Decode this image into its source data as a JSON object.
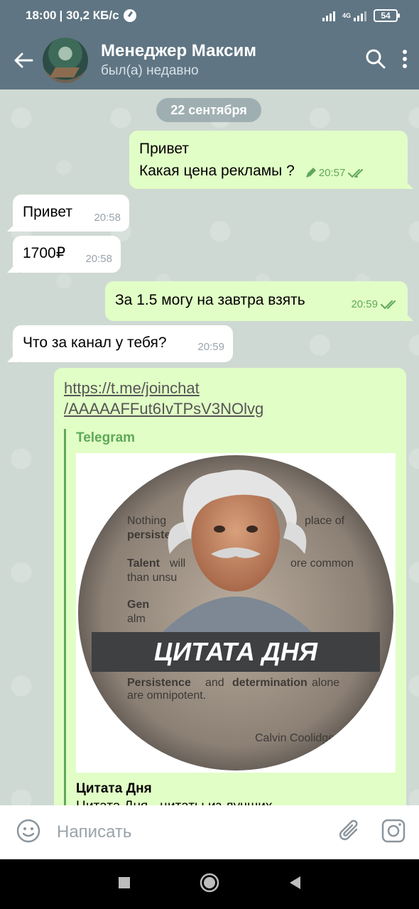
{
  "status_bar": {
    "time": "18:00",
    "speed": "| 30,2 КБ/с",
    "network": "4G",
    "battery": "54"
  },
  "header": {
    "name": "Менеджер Максим",
    "status": "был(а) недавно"
  },
  "chat": {
    "date": "22 сентября",
    "messages": [
      {
        "dir": "out",
        "lines": [
          "Привет",
          "Какая цена рекламы ?"
        ],
        "time": "20:57",
        "edited": true
      },
      {
        "dir": "in",
        "text": "Привет",
        "time": "20:58"
      },
      {
        "dir": "in",
        "text": "1700₽",
        "time": "20:58"
      },
      {
        "dir": "out",
        "text": "За 1.5 могу на завтра взять",
        "time": "20:59"
      },
      {
        "dir": "in",
        "text": "Что за канал у тебя?",
        "time": "20:59"
      }
    ],
    "link_message": {
      "url_line1": "https://t.me/joinchat",
      "url_line2": "/AAAAAFFut6IvTPsV3NOlvg",
      "site": "Telegram",
      "image_banner": "ЦИТАТА ДНЯ",
      "image_quotes": [
        "Nothing",
        "persiste",
        "Talent",
        "will",
        "ore common",
        "than unsu",
        "Gen",
        "alm",
        "place of",
        "Persistence",
        "and",
        "determination",
        "alone",
        "are omnipotent.",
        "Calvin Coolidge"
      ],
      "title": "Цитата Дня",
      "description": "Цитата Дня - цитаты из лучших"
    }
  },
  "input": {
    "placeholder": "Написать"
  },
  "colors": {
    "header": "#5f7583",
    "outgoing": "#e1fec6",
    "incoming": "#ffffff",
    "accent": "#5fa85a"
  },
  "icons": [
    "back-arrow-icon",
    "search-icon",
    "more-vertical-icon",
    "emoji-icon",
    "attach-icon",
    "camera-icon",
    "nav-square-icon",
    "nav-home-icon",
    "nav-back-icon",
    "pencil-icon",
    "double-check-icon"
  ]
}
